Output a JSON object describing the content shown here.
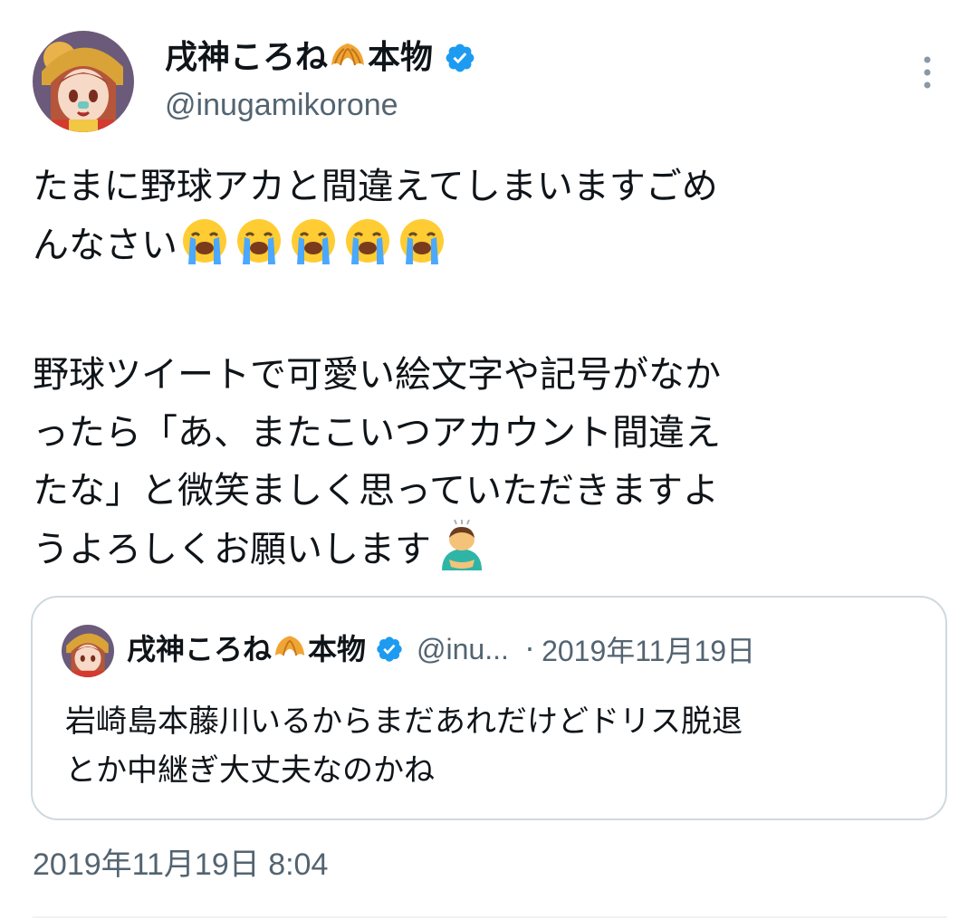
{
  "author": {
    "display_name": "戌神ころね",
    "name_emoji": "croissant-emoji",
    "name_suffix": "本物",
    "handle": "@inugamikorone",
    "verified_icon": "verified-badge-icon",
    "verified_color": "#1d9bf0"
  },
  "tweet": {
    "lines": [
      "たまに野球アカと間違えてしまいますごめ",
      "んなさい",
      "野球ツイートで可愛い絵文字や記号がなか",
      "ったら「あ、またこいつアカウント間違え",
      "たな」と微笑ましく思っていただきますよ",
      "うよろしくお願いします"
    ],
    "crying_emoji_count": 5,
    "crying_emoji": "loudly-crying-face-emoji",
    "bowing_emoji": "person-bowing-emoji"
  },
  "quote": {
    "display_name": "戌神ころね",
    "name_suffix": "本物",
    "handle": "@inu...",
    "separator": "·",
    "date": "2019年11月19日",
    "lines": [
      "岩崎島本藤川いるからまだあれだけどドリス脱退",
      "とか中継ぎ大丈夫なのかね"
    ]
  },
  "timestamp": "2019年11月19日 8:04",
  "colors": {
    "text": "#0f1419",
    "secondary": "#536471",
    "border": "#cfd9de",
    "accent": "#1d9bf0"
  }
}
